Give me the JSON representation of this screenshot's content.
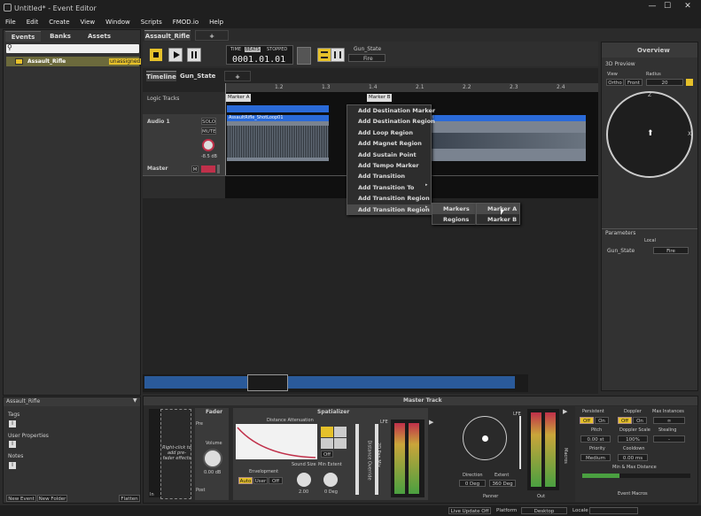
{
  "window": {
    "title": "Untitled* - Event Editor"
  },
  "menu": [
    "File",
    "Edit",
    "Create",
    "View",
    "Window",
    "Scripts",
    "FMOD.io",
    "Help"
  ],
  "browser": {
    "tabs": [
      "Events",
      "Banks",
      "Assets"
    ],
    "event_name": "Assault_Rifle",
    "event_badge": "unassigned"
  },
  "editor_tabs": {
    "active": "Assault_Rifle",
    "add": "+"
  },
  "transport": {
    "time_label": "TIME",
    "beats_label": "BEATS",
    "state": "STOPPED",
    "position": "0001.01.01"
  },
  "param_widget": {
    "name": "Gun_State",
    "value": "Fire"
  },
  "view_tabs": [
    "Timeline",
    "Gun_State"
  ],
  "ruler": [
    "1.2",
    "1.3",
    "1.4",
    "2.1",
    "2.2",
    "2.3",
    "2.4"
  ],
  "tracks": {
    "logic": "Logic Tracks",
    "audio": "Audio 1",
    "master": "Master",
    "solo": "SOLO",
    "mute": "MUTE",
    "vol": "-8.5 dB",
    "m": "M"
  },
  "markers": {
    "a": "Marker A",
    "b": "Marker B"
  },
  "clip": {
    "name": "AssaultRifle_ShotLoop01",
    "name2": "d"
  },
  "context_menu": [
    "Add Destination Marker",
    "Add Destination Region",
    "Add Loop Region",
    "Add Magnet Region",
    "Add Sustain Point",
    "Add Tempo Marker",
    "Add Transition",
    "Add Transition To",
    "Add Transition Region",
    "Add Transition Region To"
  ],
  "submenu1": [
    "Markers",
    "Regions"
  ],
  "submenu2": [
    "Marker A",
    "Marker B"
  ],
  "overview": {
    "title": "Overview",
    "preview": "3D Preview",
    "view_label": "View",
    "radius_label": "Radius",
    "ortho": "Ortho",
    "front": "Front",
    "radius": "20",
    "z": "Z",
    "x": "X"
  },
  "parameters": {
    "title": "Parameters",
    "locale": "Local",
    "name": "Gun_State",
    "value": "Fire"
  },
  "props": {
    "name": "Assault_Rifle",
    "tags": "Tags",
    "user_props": "User Properties",
    "notes": "Notes",
    "new_event": "New Event",
    "new_folder": "New Folder",
    "flatten": "Flatten"
  },
  "master_track": {
    "title": "Master Track",
    "prefader": "Right-click to add pre-fader effects",
    "fader": "Fader",
    "pre": "Pre",
    "post": "Post",
    "volume": "Volume",
    "volume_val": "0.00 dB",
    "in": "In",
    "spatializer": "Spatializer",
    "dist_att": "Distance Attenuation",
    "sound_size": "Sound Size",
    "min_extent": "Min Extent",
    "envelopment": "Envelopment",
    "auto": "Auto",
    "user": "User",
    "off": "Off",
    "sound_val": "2.00",
    "extent_val": "0 Deg",
    "distance_override": "Distance Override",
    "pan_mix": "2D Pan Mix",
    "lfe": "LFE",
    "direction": "Direction",
    "extent": "Extent",
    "dir_val": "0 Deg",
    "ext_val": "360 Deg",
    "panner": "Panner",
    "out": "Out",
    "macros": "Macros",
    "persistent": "Persistent",
    "doppler": "Doppler",
    "max_instances": "Max Instances",
    "on": "On",
    "inf": "∞",
    "pitch": "Pitch",
    "pitch_val": "0.00 st",
    "doppler_scale": "Doppler Scale",
    "doppler_val": "100%",
    "stealing": "Stealing",
    "steal_val": "-",
    "priority": "Priority",
    "priority_val": "Medium",
    "cooldown": "Cooldown",
    "cooldown_val": "0.00 ms",
    "min_max": "Min & Max Distance",
    "event_macros": "Event Macros"
  },
  "statusbar": {
    "live": "Live Update Off",
    "platform_label": "Platform",
    "platform": "Desktop",
    "locale": "Locale"
  },
  "accent": "#e6c12a",
  "clip_color": "#2a6ad8"
}
